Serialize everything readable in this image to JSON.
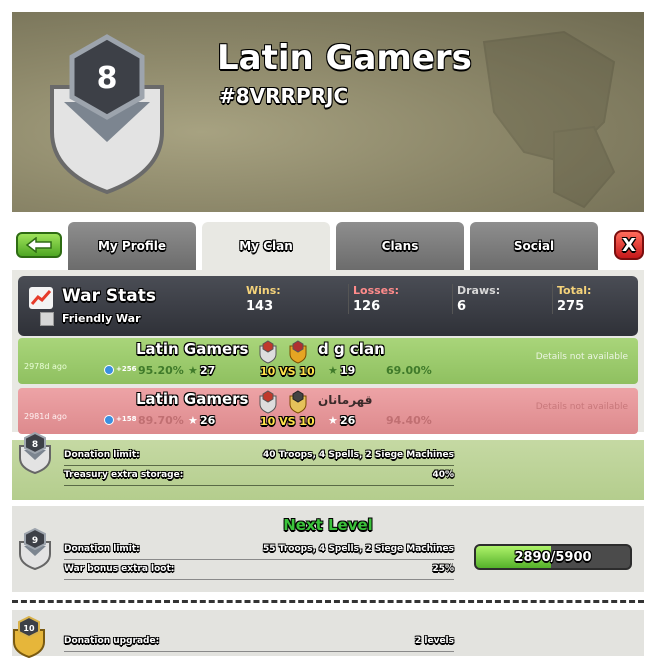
{
  "header": {
    "clan_name": "Latin Gamers",
    "clan_tag": "#8VRRPRJC",
    "clan_level": "8"
  },
  "tabs": [
    {
      "label": "My Profile"
    },
    {
      "label": "My Clan"
    },
    {
      "label": "Clans"
    },
    {
      "label": "Social"
    }
  ],
  "close_label": "X",
  "war_stats": {
    "title": "War Stats",
    "friendly_war": "Friendly War",
    "wins_label": "Wins:",
    "wins": "143",
    "losses_label": "Losses:",
    "losses": "126",
    "draws_label": "Draws:",
    "draws": "6",
    "total_label": "Total:",
    "total": "275"
  },
  "war_log": [
    {
      "ago": "2978d ago",
      "clan": "Latin Gamers",
      "opponent": "d g clan",
      "xp": "+256",
      "pct1": "95.20%",
      "stars1": "27",
      "vs": "10 VS 10",
      "stars2": "19",
      "pct2": "69.00%",
      "details": "Details not available",
      "result": "win"
    },
    {
      "ago": "2981d ago",
      "clan": "Latin Gamers",
      "opponent": "قهرمانان",
      "xp": "+158",
      "pct1": "89.70%",
      "stars1": "26",
      "vs": "10 VS 10",
      "stars2": "26",
      "pct2": "94.40%",
      "details": "Details not available",
      "result": "loss"
    }
  ],
  "current_perks": {
    "level": "8",
    "donation_label": "Donation limit:",
    "donation_value": "40 Troops, 4 Spells, 2 Siege Machines",
    "treasury_label": "Treasury extra storage:",
    "treasury_value": "40%"
  },
  "next_level": {
    "title": "Next Level",
    "level": "9",
    "donation_label": "Donation limit:",
    "donation_value": "55 Troops, 4 Spells, 2 Siege Machines",
    "loot_label": "War bonus extra loot:",
    "loot_value": "25%",
    "xp_text": "2890/5900",
    "xp_fraction": 0.49
  },
  "upgrade": {
    "level": "10",
    "label": "Donation upgrade:",
    "value": "2 levels"
  },
  "colors": {
    "win_row": "#9ccb6c",
    "loss_row": "#e7989b",
    "wins_label": "#f5d37a",
    "losses_label": "#ff8b8b",
    "draws_label": "#d8d8d8",
    "total_label": "#f5d37a"
  }
}
